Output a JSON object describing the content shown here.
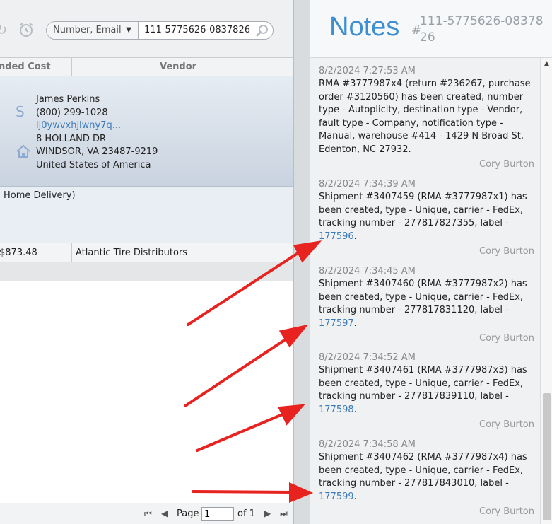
{
  "search": {
    "type_label": "Number, Email",
    "value": "111-5775626-0837826"
  },
  "grid": {
    "col_cost": "nded Cost",
    "col_vendor": "Vendor"
  },
  "contact": {
    "letter": "S",
    "name": "James Perkins",
    "phone": "(800) 299-1028",
    "email": "lj0ywvxhjlwny7q...",
    "address1": "8 HOLLAND DR",
    "address2": "WINDSOR, VA 23487-9219",
    "country": "United States of America"
  },
  "delivery": {
    "text": "Home Delivery)"
  },
  "cost_row": {
    "cost": "$873.48",
    "vendor": "Atlantic Tire Distributors"
  },
  "pager": {
    "page_label": "Page",
    "page_value": "1",
    "of_label": "of 1"
  },
  "notes": {
    "title": "Notes",
    "hash": "#",
    "order_id": "111-5775626-0837826",
    "items": [
      {
        "time": "8/2/2024 7:27:53 AM",
        "body": "RMA #3777987x4 (return #236267, purchase order #3120560) has been created, number type - Autoplicity, destination type - Vendor, fault type - Company, notification type - Manual, warehouse #414 - 1429 N Broad St, Edenton, NC 27932.",
        "author": "Cory Burton"
      },
      {
        "time": "8/2/2024 7:34:39 AM",
        "body": "Shipment #3407459 (RMA #3777987x1) has been created, type - Unique, carrier - FedEx, tracking number - 277817827355, label - ",
        "label_link": "177596",
        "suffix": ".",
        "author": "Cory Burton"
      },
      {
        "time": "8/2/2024 7:34:45 AM",
        "body": "Shipment #3407460 (RMA #3777987x2) has been created, type - Unique, carrier - FedEx, tracking number - 277817831120, label - ",
        "label_link": "177597",
        "suffix": ".",
        "author": "Cory Burton"
      },
      {
        "time": "8/2/2024 7:34:52 AM",
        "body": "Shipment #3407461 (RMA #3777987x3) has been created, type - Unique, carrier - FedEx, tracking number - 277817839110, label - ",
        "label_link": "177598",
        "suffix": ".",
        "author": "Cory Burton"
      },
      {
        "time": "8/2/2024 7:34:58 AM",
        "body": "Shipment #3407462 (RMA #3777987x4) has been created, type - Unique, carrier - FedEx, tracking number - 277817843010, label - ",
        "label_link": "177599",
        "suffix": ".",
        "author": "Cory Burton"
      }
    ]
  },
  "colors": {
    "accent": "#3d8fd1",
    "link": "#3b7ab8",
    "annotation_arrow": "#e8231f"
  }
}
